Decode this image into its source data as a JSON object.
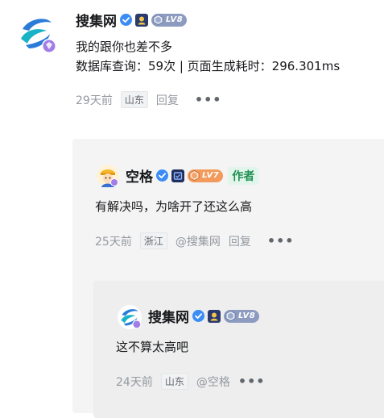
{
  "main_comment": {
    "username": "搜集网",
    "level": "LV8",
    "lines": [
      "我的跟你也差不多",
      "数据库查询：59次 | 页面生成耗时：296.301ms"
    ],
    "time": "29天前",
    "location": "山东",
    "reply_label": "回复",
    "more_label": "•••"
  },
  "reply1": {
    "username": "空格",
    "level": "LV7",
    "author_tag": "作者",
    "text": "有解决吗，为啥开了还这么高",
    "time": "25天前",
    "location": "浙江",
    "mention": "@搜集网",
    "reply_label": "回复",
    "more_label": "•••"
  },
  "reply2": {
    "username": "搜集网",
    "level": "LV8",
    "text": "这不算太高吧",
    "time": "24天前",
    "location": "山东",
    "mention": "@空格",
    "more_label": "•••"
  },
  "colors": {
    "lv8": "#8c9bbf",
    "lv7": "#f29b5c",
    "verify": "#3b8cf5",
    "author_bg": "#e2f5ea",
    "author_fg": "#1e8f50",
    "panel_bg": "#f4f4f4"
  }
}
